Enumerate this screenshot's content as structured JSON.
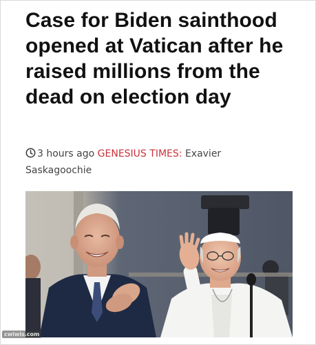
{
  "article": {
    "headline": "Case for Biden sainthood opened at Vatican after he raised millions from the dead on election day",
    "time": "3 hours ago",
    "source": "GENESIUS TIMES:",
    "author": "Exavier Saskagoochie"
  },
  "icons": {
    "time": "clock-icon"
  },
  "colors": {
    "source": "#c9313a",
    "headline": "#111111",
    "meta": "#444444"
  },
  "watermark": "cwiwis.com"
}
